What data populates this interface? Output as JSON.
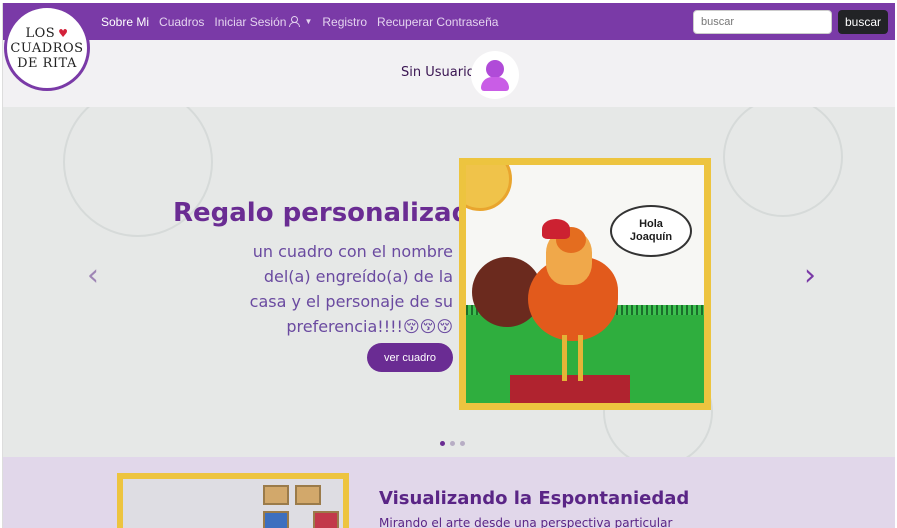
{
  "logo": {
    "line1": "LOS",
    "line2": "CUADROS",
    "line3": "DE RITA",
    "heart": "♥"
  },
  "navbar": {
    "items": [
      {
        "label": "Sobre Mi",
        "active": true
      },
      {
        "label": "Cuadros",
        "active": false
      },
      {
        "label": "Iniciar Sesión",
        "active": false,
        "icon": "user-icon",
        "dropdown": true
      },
      {
        "label": "Registro",
        "active": false
      },
      {
        "label": "Recuperar Contraseña",
        "active": false
      }
    ],
    "search": {
      "placeholder": "buscar",
      "button_label": "buscar"
    },
    "color": "#7a3aa7"
  },
  "user": {
    "name": "Sin Usuario",
    "avatar_icon": "user-avatar-icon"
  },
  "carousel": {
    "title": "Regalo personalizado:",
    "text": "un cuadro con el nombre del(a) engreído(a) de la casa y el personaje de su preferencia!!!!😚😚😚",
    "button_label": "ver cuadro",
    "image": {
      "bubble_line1": "Hola",
      "bubble_line2": "Joaquín"
    },
    "prev_icon": "chevron-left-icon",
    "next_icon": "chevron-right-icon",
    "prev_glyph": "‹",
    "next_glyph": "›",
    "slides": 3,
    "active_slide": 1
  },
  "section2": {
    "title": "Visualizando la Espontaniedad",
    "subtitle": "Mirando el arte desde una perspectiva particular"
  },
  "colors": {
    "accent": "#6a2c93",
    "frame": "#edc43f",
    "dark_button": "#222326"
  }
}
